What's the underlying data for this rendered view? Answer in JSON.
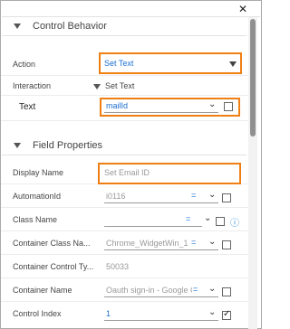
{
  "header": {
    "close_glyph": "✕"
  },
  "control_behavior": {
    "title": "Control Behavior",
    "action": {
      "label": "Action",
      "value": "Set Text"
    },
    "interaction": {
      "label": "Interaction",
      "value": "Set Text"
    },
    "text": {
      "label": "Text",
      "value": "mailId",
      "checked": false
    }
  },
  "field_properties": {
    "title": "Field Properties",
    "rows": [
      {
        "label": "Display Name",
        "value": "Set Email ID"
      },
      {
        "label": "AutomationId",
        "value": "i0116",
        "operator": "=",
        "checked": false
      },
      {
        "label": "Class Name",
        "value": "",
        "operator": "=",
        "checked": false,
        "info_icon": "info-icon"
      },
      {
        "label": "Container Class Na...",
        "value": "Chrome_WidgetWin_1",
        "operator": "=",
        "checked": false
      },
      {
        "label": "Container Control Ty...",
        "value": "50033"
      },
      {
        "label": "Container Name",
        "value": "Oauth sign-in - Google Cl",
        "operator": "=",
        "checked": false
      },
      {
        "label": "Control Index",
        "value": "1",
        "checked": true
      }
    ]
  },
  "colors": {
    "highlight": "#ef7e13",
    "link_blue": "#1a6fd1"
  }
}
